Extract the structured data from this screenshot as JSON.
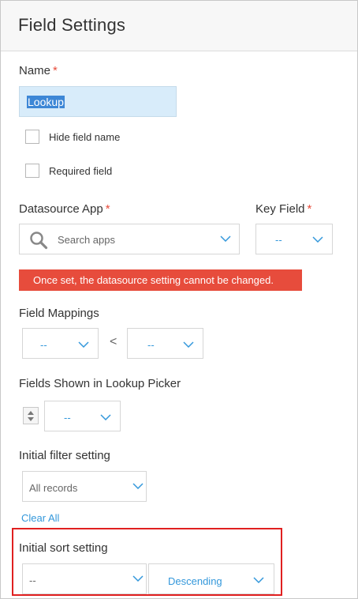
{
  "header": {
    "title": "Field Settings"
  },
  "name": {
    "label": "Name",
    "required_mark": "*",
    "value": "Lookup"
  },
  "hide_field_name": {
    "label": "Hide field name"
  },
  "required_field": {
    "label": "Required field"
  },
  "datasource": {
    "label": "Datasource App",
    "required_mark": "*",
    "search_placeholder": "Search apps",
    "error": "Once set, the datasource setting cannot be changed."
  },
  "key_field": {
    "label": "Key Field",
    "required_mark": "*",
    "value": "--"
  },
  "field_mappings": {
    "label": "Field Mappings",
    "left_value": "--",
    "right_value": "--",
    "arrow": "<"
  },
  "lookup_picker": {
    "label": "Fields Shown in Lookup Picker",
    "value": "--"
  },
  "initial_filter": {
    "label": "Initial filter setting",
    "value": "All records",
    "clear_all": "Clear All"
  },
  "initial_sort": {
    "label": "Initial sort setting",
    "field_value": "--",
    "order_value": "Descending"
  },
  "colors": {
    "accent": "#3498db",
    "error": "#e74c3c",
    "required": "#e74c3c",
    "highlight": "#e02020",
    "selection": "#3d87d6"
  }
}
